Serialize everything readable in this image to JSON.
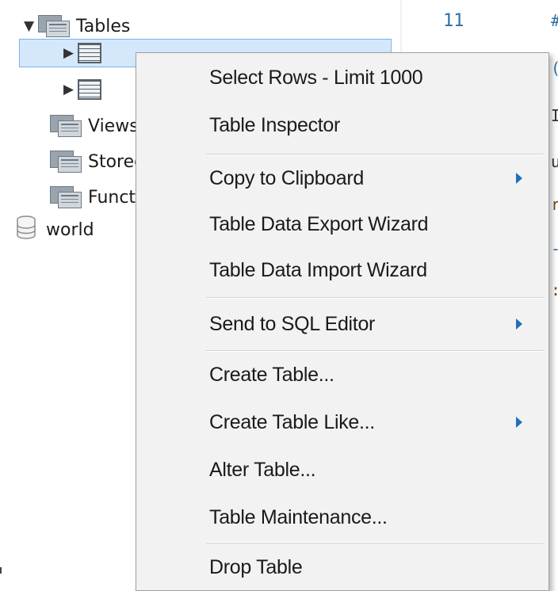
{
  "tree": {
    "tables_label": "Tables",
    "views_label": "Views",
    "stored_label": "Stored Procedures",
    "functions_label": "Functions",
    "world_label": "world"
  },
  "editor": {
    "line_number": "11"
  },
  "context_menu": {
    "items": [
      {
        "label": "Select Rows - Limit 1000"
      },
      {
        "label": "Table Inspector"
      },
      {
        "label": "Copy to Clipboard",
        "submenu": true
      },
      {
        "label": "Table Data Export Wizard"
      },
      {
        "label": "Table Data Import Wizard"
      },
      {
        "label": "Send to SQL Editor",
        "submenu": true
      },
      {
        "label": "Create Table..."
      },
      {
        "label": "Create Table Like...",
        "submenu": true
      },
      {
        "label": "Alter Table..."
      },
      {
        "label": "Table Maintenance..."
      },
      {
        "label": "Drop Table"
      }
    ]
  },
  "colors": {
    "selection_fill": "#d5e8fb",
    "selection_border": "#74b5f0",
    "submenu_arrow": "#1f6fbe",
    "menu_background": "#f2f2f2"
  }
}
